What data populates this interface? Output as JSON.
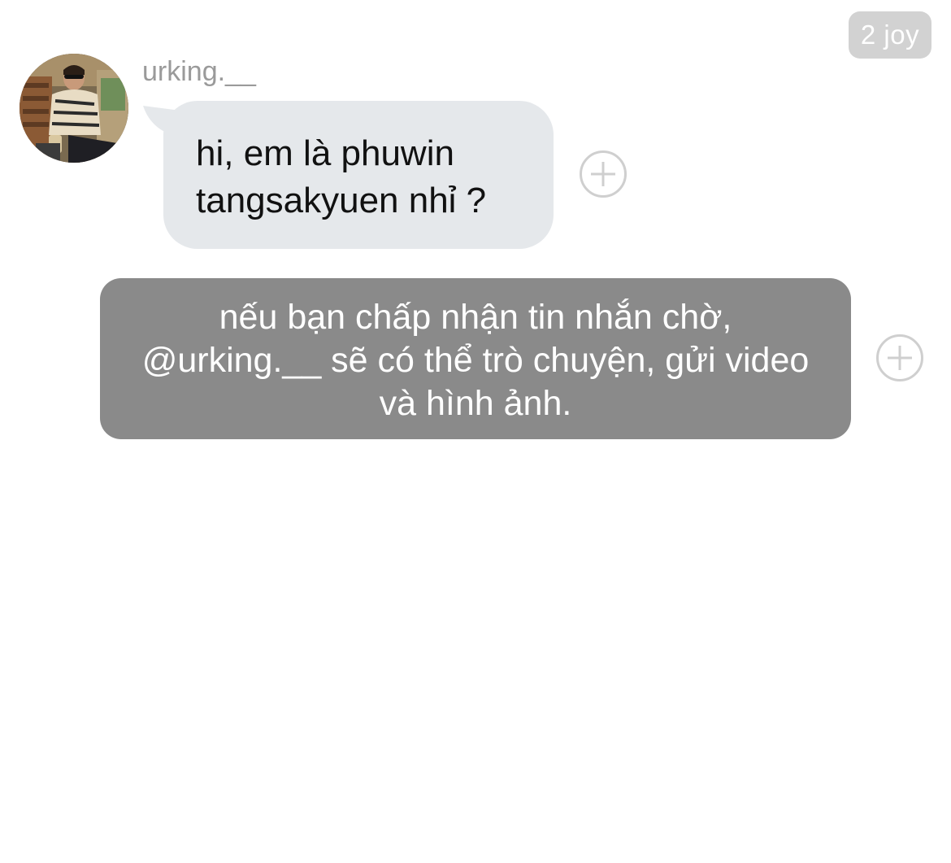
{
  "header": {
    "timestamp": "2 joy"
  },
  "conversation": {
    "sender": {
      "username": "urking.__",
      "avatar_icon": "profile-photo"
    },
    "incoming_message": {
      "lines": [
        "hi, em là phuwin",
        "tangsakyuen nhỉ ?"
      ]
    },
    "request_notice": {
      "lines": [
        "nếu bạn chấp nhận tin nhắn chờ,",
        "@urking.__ sẽ có thể trò chuyện, gửi video",
        "và hình ảnh."
      ]
    },
    "add_reaction_icon": "plus-circle-icon"
  },
  "colors": {
    "incoming_bubble": "#e5e8eb",
    "notice_bubble": "#8a8a8a",
    "timestamp_badge": "#d2d2d2",
    "username_text": "#9a9a9a"
  }
}
